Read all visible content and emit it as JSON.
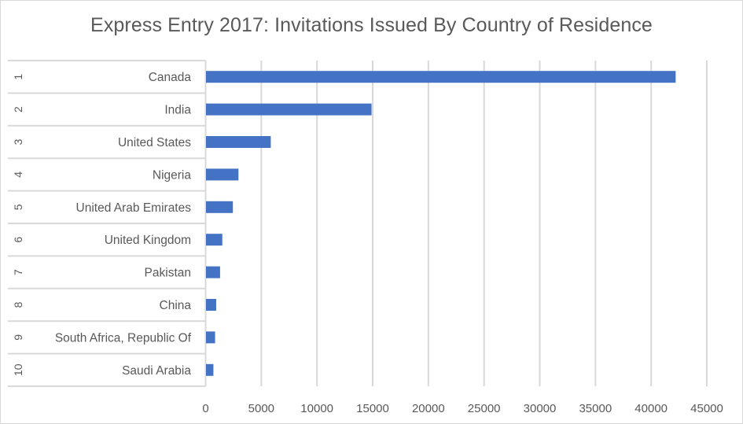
{
  "chart_data": {
    "type": "bar",
    "orientation": "horizontal",
    "title": "Express Entry 2017: Invitations Issued By Country of Residence",
    "xlabel": "",
    "ylabel": "",
    "xlim": [
      0,
      45000
    ],
    "x_ticks": [
      0,
      5000,
      10000,
      15000,
      20000,
      25000,
      30000,
      35000,
      40000,
      45000
    ],
    "x_tick_labels": [
      "0",
      "5000",
      "10000",
      "15000",
      "20000",
      "25000",
      "30000",
      "35000",
      "40000",
      "45000"
    ],
    "grid": "vertical",
    "legend": "none",
    "bar_color": "#4472C4",
    "categories": [
      {
        "rank": "1",
        "name": "Canada"
      },
      {
        "rank": "2",
        "name": "India"
      },
      {
        "rank": "3",
        "name": "United States"
      },
      {
        "rank": "4",
        "name": "Nigeria"
      },
      {
        "rank": "5",
        "name": "United Arab Emirates"
      },
      {
        "rank": "6",
        "name": "United Kingdom"
      },
      {
        "rank": "7",
        "name": "Pakistan"
      },
      {
        "rank": "8",
        "name": "China"
      },
      {
        "rank": "9",
        "name": "South Africa, Republic Of"
      },
      {
        "rank": "10",
        "name": "Saudi Arabia"
      }
    ],
    "series": [
      {
        "name": "Invitations Issued",
        "values": [
          42200,
          14900,
          5850,
          2950,
          2450,
          1500,
          1300,
          950,
          850,
          700
        ]
      }
    ]
  }
}
